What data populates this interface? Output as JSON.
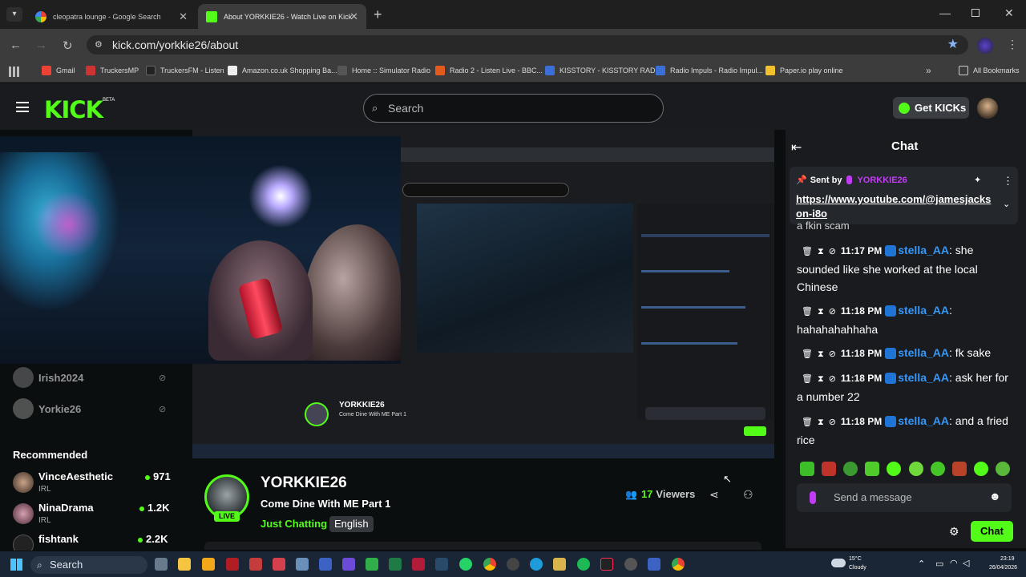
{
  "browser": {
    "tabs": [
      {
        "title": "cleopatra lounge - Google Search",
        "active": false
      },
      {
        "title": "About YORKKIE26 - Watch Live on Kick",
        "active": true
      }
    ],
    "url": "kick.com/yorkkie26/about",
    "bookmarks": [
      "Gmail",
      "TruckersMP",
      "TruckersFM - Listen",
      "Amazon.co.uk Shopping Ba...",
      "Home :: Simulator Radio",
      "Radio 2 - Listen Live - BBC...",
      "KISSTORY - KISSTORY RADI...",
      "Radio Impuls - Radio Impul...",
      "Paper.io play online"
    ],
    "all_bookmarks": "All Bookmarks"
  },
  "kick": {
    "logo": "KICK",
    "beta": "BETA",
    "search_placeholder": "Search",
    "get_kicks": "Get KICKs"
  },
  "sidebar": {
    "following": [
      {
        "name": "Irish2024"
      },
      {
        "name": "Yorkie26"
      }
    ],
    "recommended_heading": "Recommended",
    "recommended": [
      {
        "name": "VinceAesthetic",
        "category": "IRL",
        "viewers": "971"
      },
      {
        "name": "NinaDrama",
        "category": "IRL",
        "viewers": "1.2K"
      },
      {
        "name": "fishtank",
        "category": "IRL",
        "viewers": "2.2K"
      }
    ]
  },
  "stream": {
    "streamer": "YORKKIE26",
    "title": "Come Dine With ME Part 1",
    "category": "Just Chatting",
    "language": "English",
    "live_badge": "LIVE",
    "viewers_count": "17",
    "viewers_label": "Viewers"
  },
  "chat": {
    "title": "Chat",
    "pinned": {
      "sent_by_label": "Sent by",
      "sender": "YORKKIE26",
      "link": "https://www.youtube.com/@jamesjackson-i8o"
    },
    "partial_line": "a fkin scam",
    "messages": [
      {
        "time": "11:17 PM",
        "user": "stella_AA",
        "text": "she sounded like she worked at the local Chinese"
      },
      {
        "time": "11:18 PM",
        "user": "stella_AA",
        "text": "hahahahahhaha"
      },
      {
        "time": "11:18 PM",
        "user": "stella_AA",
        "text": "fk sake"
      },
      {
        "time": "11:18 PM",
        "user": "stella_AA",
        "text": "ask her for a number 22"
      },
      {
        "time": "11:18 PM",
        "user": "stella_AA",
        "text": "and a fried rice"
      }
    ],
    "input_placeholder": "Send a message",
    "send_button": "Chat"
  },
  "taskbar": {
    "search": "Search",
    "weather_temp": "15°C",
    "weather_desc": "Cloudy",
    "time": "23:19",
    "date": "26/04/2026"
  },
  "colors": {
    "kick_green": "#53fc18",
    "username_blue": "#3598f8",
    "bg_dark": "#0b0e0f",
    "panel": "#191b1f"
  }
}
